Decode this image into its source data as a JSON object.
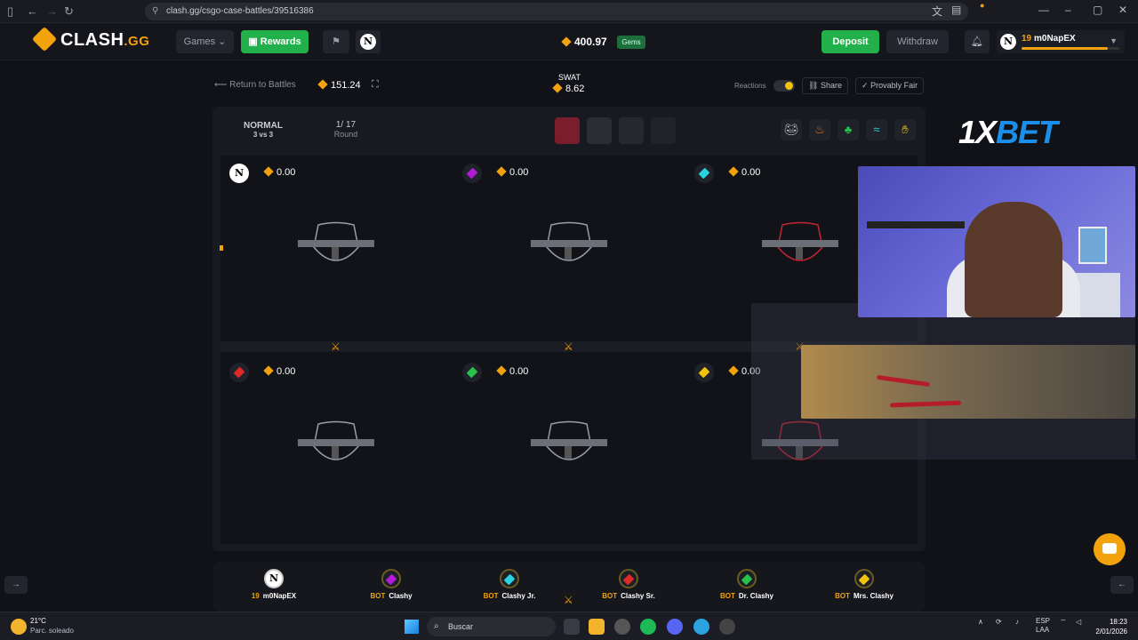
{
  "browser": {
    "url": "clash.gg/csgo-case-battles/39516386"
  },
  "header": {
    "logo": "CLASH",
    "logo_suffix": ".GG",
    "games_label": "Games",
    "rewards_label": "Rewards",
    "balance": "400.97",
    "gems_label": "Gems",
    "deposit_label": "Deposit",
    "withdraw_label": "Withdraw",
    "user": {
      "level": "19",
      "name": "m0NapEX",
      "xp_fraction": 0.88
    }
  },
  "battle_bar": {
    "return_label": "Return to Battles",
    "cost": "151.24",
    "case_name": "SWAT",
    "case_price": "8.62",
    "reactions_label": "Reactions",
    "share_label": "Share",
    "provably_fair_label": "Provably Fair"
  },
  "battle": {
    "mode": "NORMAL",
    "mode_sub": "3 vs 3",
    "round": "1/ 17",
    "round_label": "Round",
    "slots": [
      {
        "value": "0.00",
        "gem": "#ffffff",
        "avatar": true
      },
      {
        "value": "0.00",
        "gem": "#b21ad8"
      },
      {
        "value": "0.00",
        "gem": "#2ad2e0"
      },
      {
        "value": "0.00",
        "gem": "#e02a2a"
      },
      {
        "value": "0.00",
        "gem": "#27c24a"
      },
      {
        "value": "0.00",
        "gem": "#f2c20c"
      }
    ]
  },
  "players": [
    {
      "level": "19",
      "name": "m0NapEX",
      "gem": "#ffffff",
      "avatar": true
    },
    {
      "tag": "BOT",
      "name": "Clashy",
      "gem": "#b21ad8"
    },
    {
      "tag": "BOT",
      "name": "Clashy Jr.",
      "gem": "#2ad2e0"
    },
    {
      "tag": "BOT",
      "name": "Clashy Sr.",
      "gem": "#e02a2a"
    },
    {
      "tag": "BOT",
      "name": "Dr. Clashy",
      "gem": "#27c24a"
    },
    {
      "tag": "BOT",
      "name": "Mrs. Clashy",
      "gem": "#f2c20c"
    }
  ],
  "overlay": {
    "brand_a": "1X",
    "brand_b": "BET"
  },
  "taskbar": {
    "temp": "21°C",
    "weather": "Parc. soleado",
    "search_placeholder": "Buscar",
    "lang_a": "ESP",
    "lang_b": "LAA",
    "time": "18:23",
    "date": "2/01/2026"
  },
  "colors": {
    "accent": "#f2a20c",
    "green": "#22b04b",
    "bg": "#101218"
  }
}
